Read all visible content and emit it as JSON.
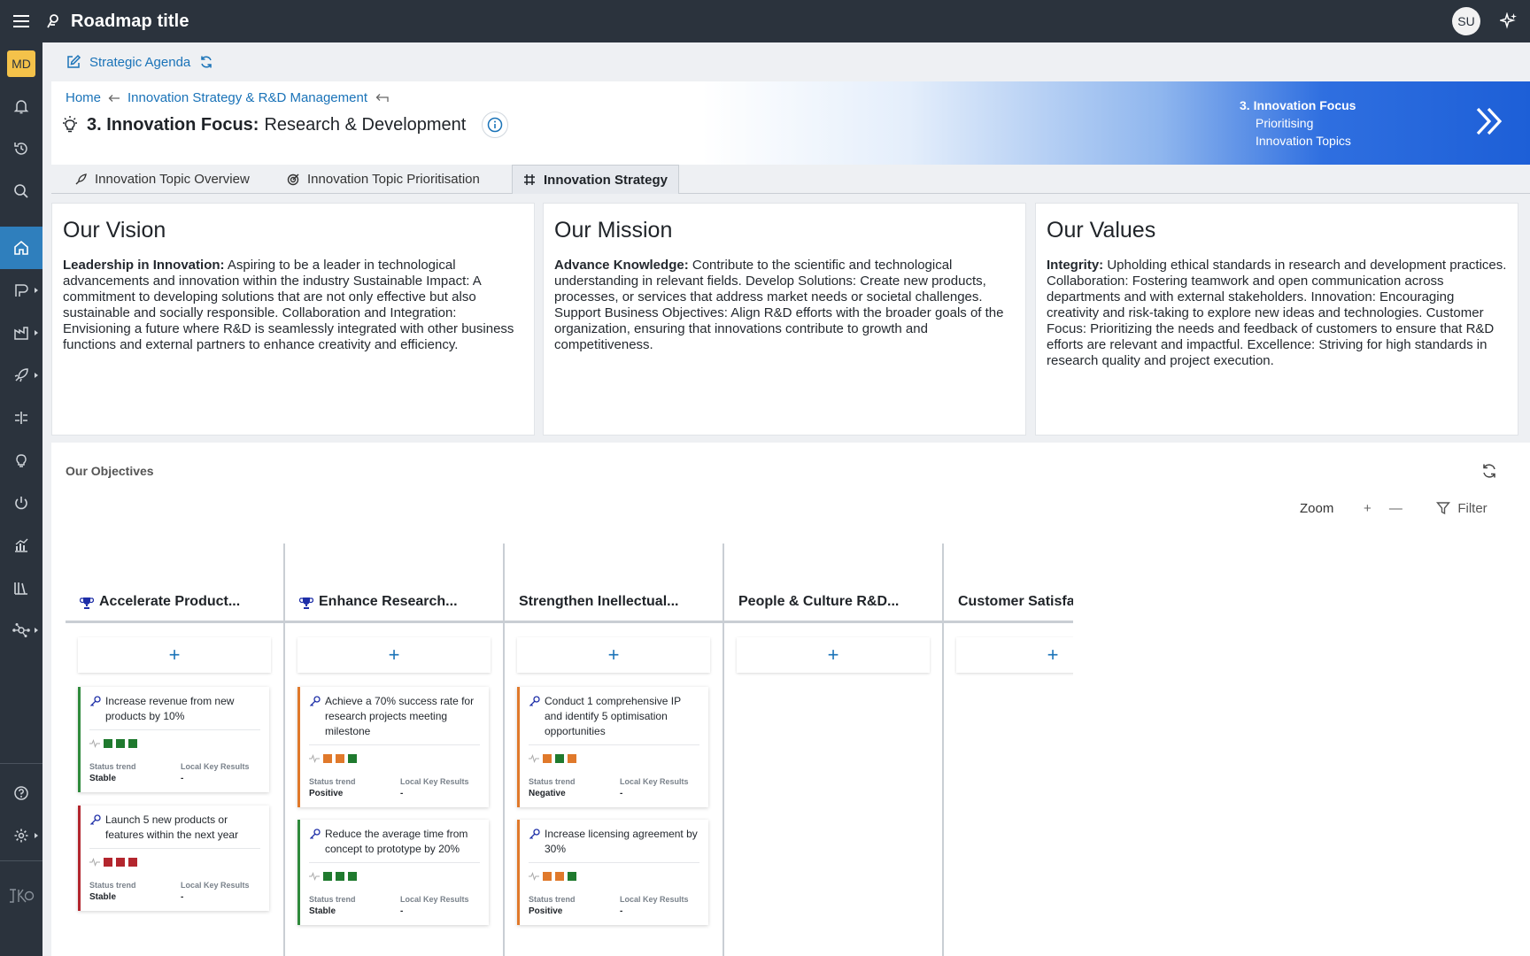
{
  "app": {
    "title": "Roadmap title",
    "user_initials": "SU",
    "workspace_initials": "MD"
  },
  "subheader": {
    "label": "Strategic Agenda"
  },
  "breadcrumb": {
    "home": "Home",
    "parent": "Innovation Strategy & R&D Management"
  },
  "page": {
    "title_bold": "3. Innovation Focus:",
    "title_rest": "Research & Development"
  },
  "step": {
    "heading": "3. Innovation Focus",
    "line1": "Prioritising",
    "line2": "Innovation Topics"
  },
  "tabs": [
    {
      "label": "Innovation Topic Overview",
      "icon": "rocket-icon"
    },
    {
      "label": "Innovation Topic Prioritisation",
      "icon": "target-icon"
    },
    {
      "label": "Innovation Strategy",
      "icon": "hash-icon",
      "active": true
    }
  ],
  "cards": {
    "vision": {
      "title": "Our Vision",
      "lead": "Leadership in Innovation:",
      "body": " Aspiring to be a leader in technological advancements and innovation within the industry Sustainable Impact: A commitment to developing solutions that are not only effective but also sustainable and socially responsible. Collaboration and Integration: Envisioning a future where R&D is seamlessly integrated with other business functions and external partners to enhance creativity and efficiency."
    },
    "mission": {
      "title": "Our Mission",
      "lead": "Advance Knowledge:",
      "body": " Contribute to the scientific and technological understanding in relevant fields. Develop Solutions: Create new products, processes, or services that address market needs or societal challenges. Support Business Objectives: Align R&D efforts with the broader goals of the organization, ensuring that innovations contribute to growth and competitiveness."
    },
    "values": {
      "title": "Our Values",
      "lead": "Integrity:",
      "body": " Upholding ethical standards in research and development practices. Collaboration: Fostering teamwork and open communication across departments and with external stakeholders. Innovation: Encouraging creativity and risk-taking to explore new ideas and technologies. Customer Focus: Prioritizing the needs and feedback of customers to ensure that R&D efforts are relevant and impactful. Excellence: Striving for high standards in research quality and project execution."
    }
  },
  "objectives": {
    "title": "Our Objectives",
    "zoom_label": "Zoom",
    "zoom_in": "+",
    "zoom_out": "—",
    "filter_label": "Filter",
    "add_label": "+",
    "status_trend_label": "Status trend",
    "local_kr_label": "Local Key Results",
    "columns": [
      {
        "title": "Accelerate Product...",
        "trophy": true,
        "cards": [
          {
            "text": "Increase revenue from new products by 10%",
            "accent": "#2f8a3c",
            "squares": [
              "#1f7a2e",
              "#1f7a2e",
              "#1f7a2e"
            ],
            "status": "Stable",
            "krs": "-"
          },
          {
            "text": "Launch 5 new products or features within the next year",
            "accent": "#b3262e",
            "squares": [
              "#b3262e",
              "#b3262e",
              "#b3262e"
            ],
            "status": "Stable",
            "krs": "-"
          }
        ]
      },
      {
        "title": "Enhance Research...",
        "trophy": true,
        "cards": [
          {
            "text": "Achieve a 70% success rate for research projects meeting milestone",
            "accent": "#e0792b",
            "squares": [
              "#e0792b",
              "#e0792b",
              "#1f7a2e"
            ],
            "status": "Positive",
            "krs": "-"
          },
          {
            "text": "Reduce the average time from concept to prototype by 20%",
            "accent": "#2f8a3c",
            "squares": [
              "#1f7a2e",
              "#1f7a2e",
              "#1f7a2e"
            ],
            "status": "Stable",
            "krs": "-"
          }
        ]
      },
      {
        "title": "Strengthen Inellectual...",
        "trophy": false,
        "cards": [
          {
            "text": "Conduct 1 comprehensive IP and identify 5 optimisation opportunities",
            "accent": "#e0792b",
            "squares": [
              "#e0792b",
              "#1f7a2e",
              "#e0792b"
            ],
            "status": "Negative",
            "krs": "-"
          },
          {
            "text": "Increase licensing agreement by 30%",
            "accent": "#e0792b",
            "squares": [
              "#e0792b",
              "#e0792b",
              "#1f7a2e"
            ],
            "status": "Positive",
            "krs": "-"
          }
        ]
      },
      {
        "title": "People & Culture R&D...",
        "trophy": false,
        "cards": []
      },
      {
        "title": "Customer Satisfa",
        "trophy": false,
        "cards": []
      }
    ]
  }
}
